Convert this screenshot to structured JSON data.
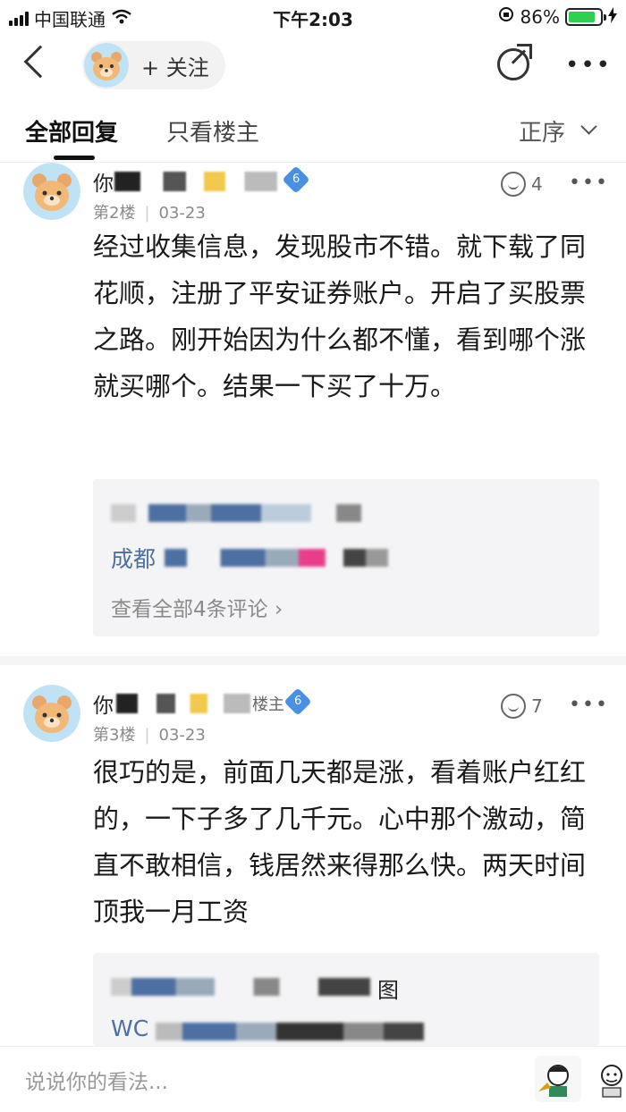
{
  "status": {
    "carrier": "中国联通",
    "time": "下午2:03",
    "battery": "86%",
    "battery_level": 0.86
  },
  "header": {
    "follow_label": "+ 关注"
  },
  "tabs": {
    "all_label": "全部回复",
    "owner_label": "只看楼主",
    "sort_label": "正序"
  },
  "posts": [
    {
      "name": "你",
      "level": "6",
      "floor": "第2楼",
      "date": "03-23",
      "likes": "4",
      "content": "经过收集信息，发现股市不错。就下载了同花顺，注册了平安证券账户。开启了买股票之路。刚开始因为什么都不懂，看到哪个涨就买哪个。结果一下买了十万。",
      "reply_name": "成都",
      "view_all": "查看全部4条评论"
    },
    {
      "name": "你",
      "level": "6",
      "owner_tag": "楼主",
      "floor": "第3楼",
      "date": "03-23",
      "likes": "7",
      "content": "很巧的是，前面几天都是涨，看着账户红红的，一下子多了几千元。心中那个激动，简直不敢相信，钱居然来得那么快。两天时间顶我一月工资",
      "reply_snippet": "图",
      "reply_name": "WC"
    }
  ],
  "bottom": {
    "input_placeholder": "说说你的看法..."
  },
  "colors": {
    "link": "#4d6fa1",
    "badge": "#4a90e2",
    "reply_bg": "#f4f4f6"
  }
}
